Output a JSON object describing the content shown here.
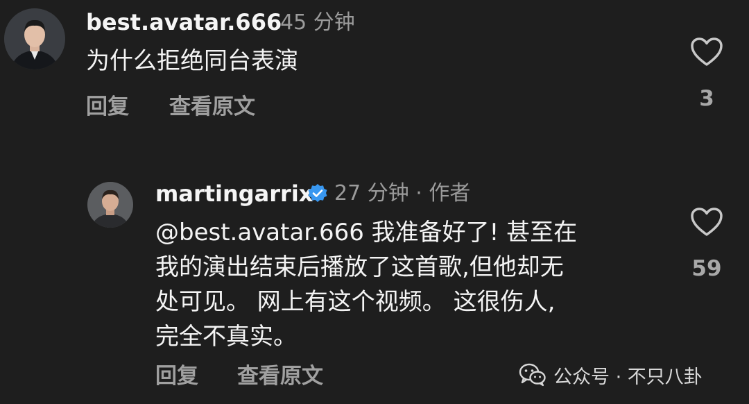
{
  "comments": [
    {
      "username": "best.avatar.666",
      "time": "45 分钟",
      "text": "为什么拒绝同台表演",
      "reply_label": "回复",
      "translate_label": "查看原文",
      "likes": "3",
      "avatar_icon": "user-avatar-man-suit"
    },
    {
      "username": "martingarrix",
      "verified": true,
      "time": "27 分钟 · 作者",
      "text_lines": [
        "@best.avatar.666 我准备好了! 甚至在",
        "我的演出结束后播放了这首歌,但他却无",
        "处可见。 网上有这个视频。 这很伤人,",
        "完全不真实。"
      ],
      "reply_label": "回复",
      "translate_label": "查看原文",
      "likes": "59",
      "avatar_icon": "user-avatar-man"
    }
  ],
  "watermark": {
    "text": "公众号 · 不只八卦",
    "icon": "wechat-icon"
  },
  "colors": {
    "background": "#1e1e1e",
    "verified_badge": "#3897f0",
    "secondary_text": "#9b9b9b"
  }
}
